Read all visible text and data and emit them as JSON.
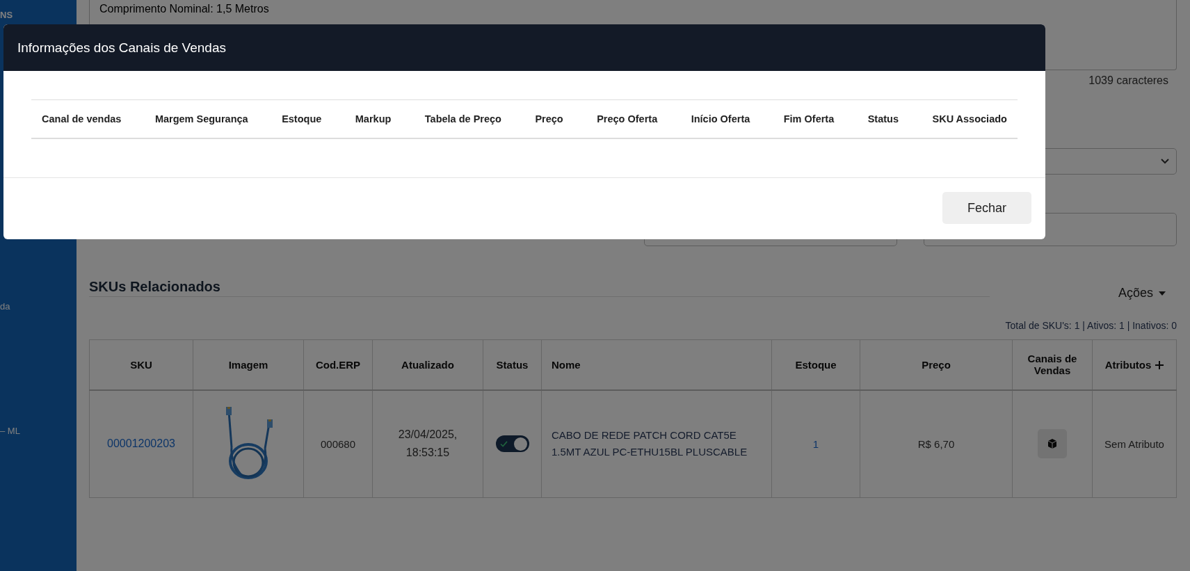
{
  "sidebar": {
    "items": [
      {
        "label": "NS"
      },
      {
        "label": "da"
      },
      {
        "label": "– ML"
      }
    ]
  },
  "description": {
    "lines": [
      "Comprimento Nominal: 1,5 Metros"
    ],
    "char_count": "1039 caracteres"
  },
  "section_title": "SKUs Relacionados",
  "actions_menu": {
    "label": "Ações"
  },
  "summary": "Total de SKU's: 1 | Ativos: 1 | Inativos: 0",
  "sku_table": {
    "columns": [
      "SKU",
      "Imagem",
      "Cod.ERP",
      "Atualizado",
      "Status",
      "Nome",
      "Estoque",
      "Preço",
      "Canais de Vendas",
      "Atributos"
    ],
    "rows": [
      {
        "sku": "00001200203",
        "cod_erp": "000680",
        "updated": "23/04/2025, 18:53:15",
        "status_on": true,
        "name": "CABO DE REDE PATCH CORD CAT5E 1.5MT AZUL PC-ETHU15BL PLUSCABLE",
        "stock": "1",
        "price": "R$ 6,70",
        "attributes": "Sem Atributo"
      }
    ]
  },
  "modal": {
    "title": "Informações dos Canais de Vendas",
    "columns": [
      "Canal de vendas",
      "Margem Segurança",
      "Estoque",
      "Markup",
      "Tabela de Preço",
      "Preço",
      "Preço Oferta",
      "Início Oferta",
      "Fim Oferta",
      "Status",
      "SKU Associado"
    ],
    "buttons": [
      "Fechar"
    ]
  }
}
